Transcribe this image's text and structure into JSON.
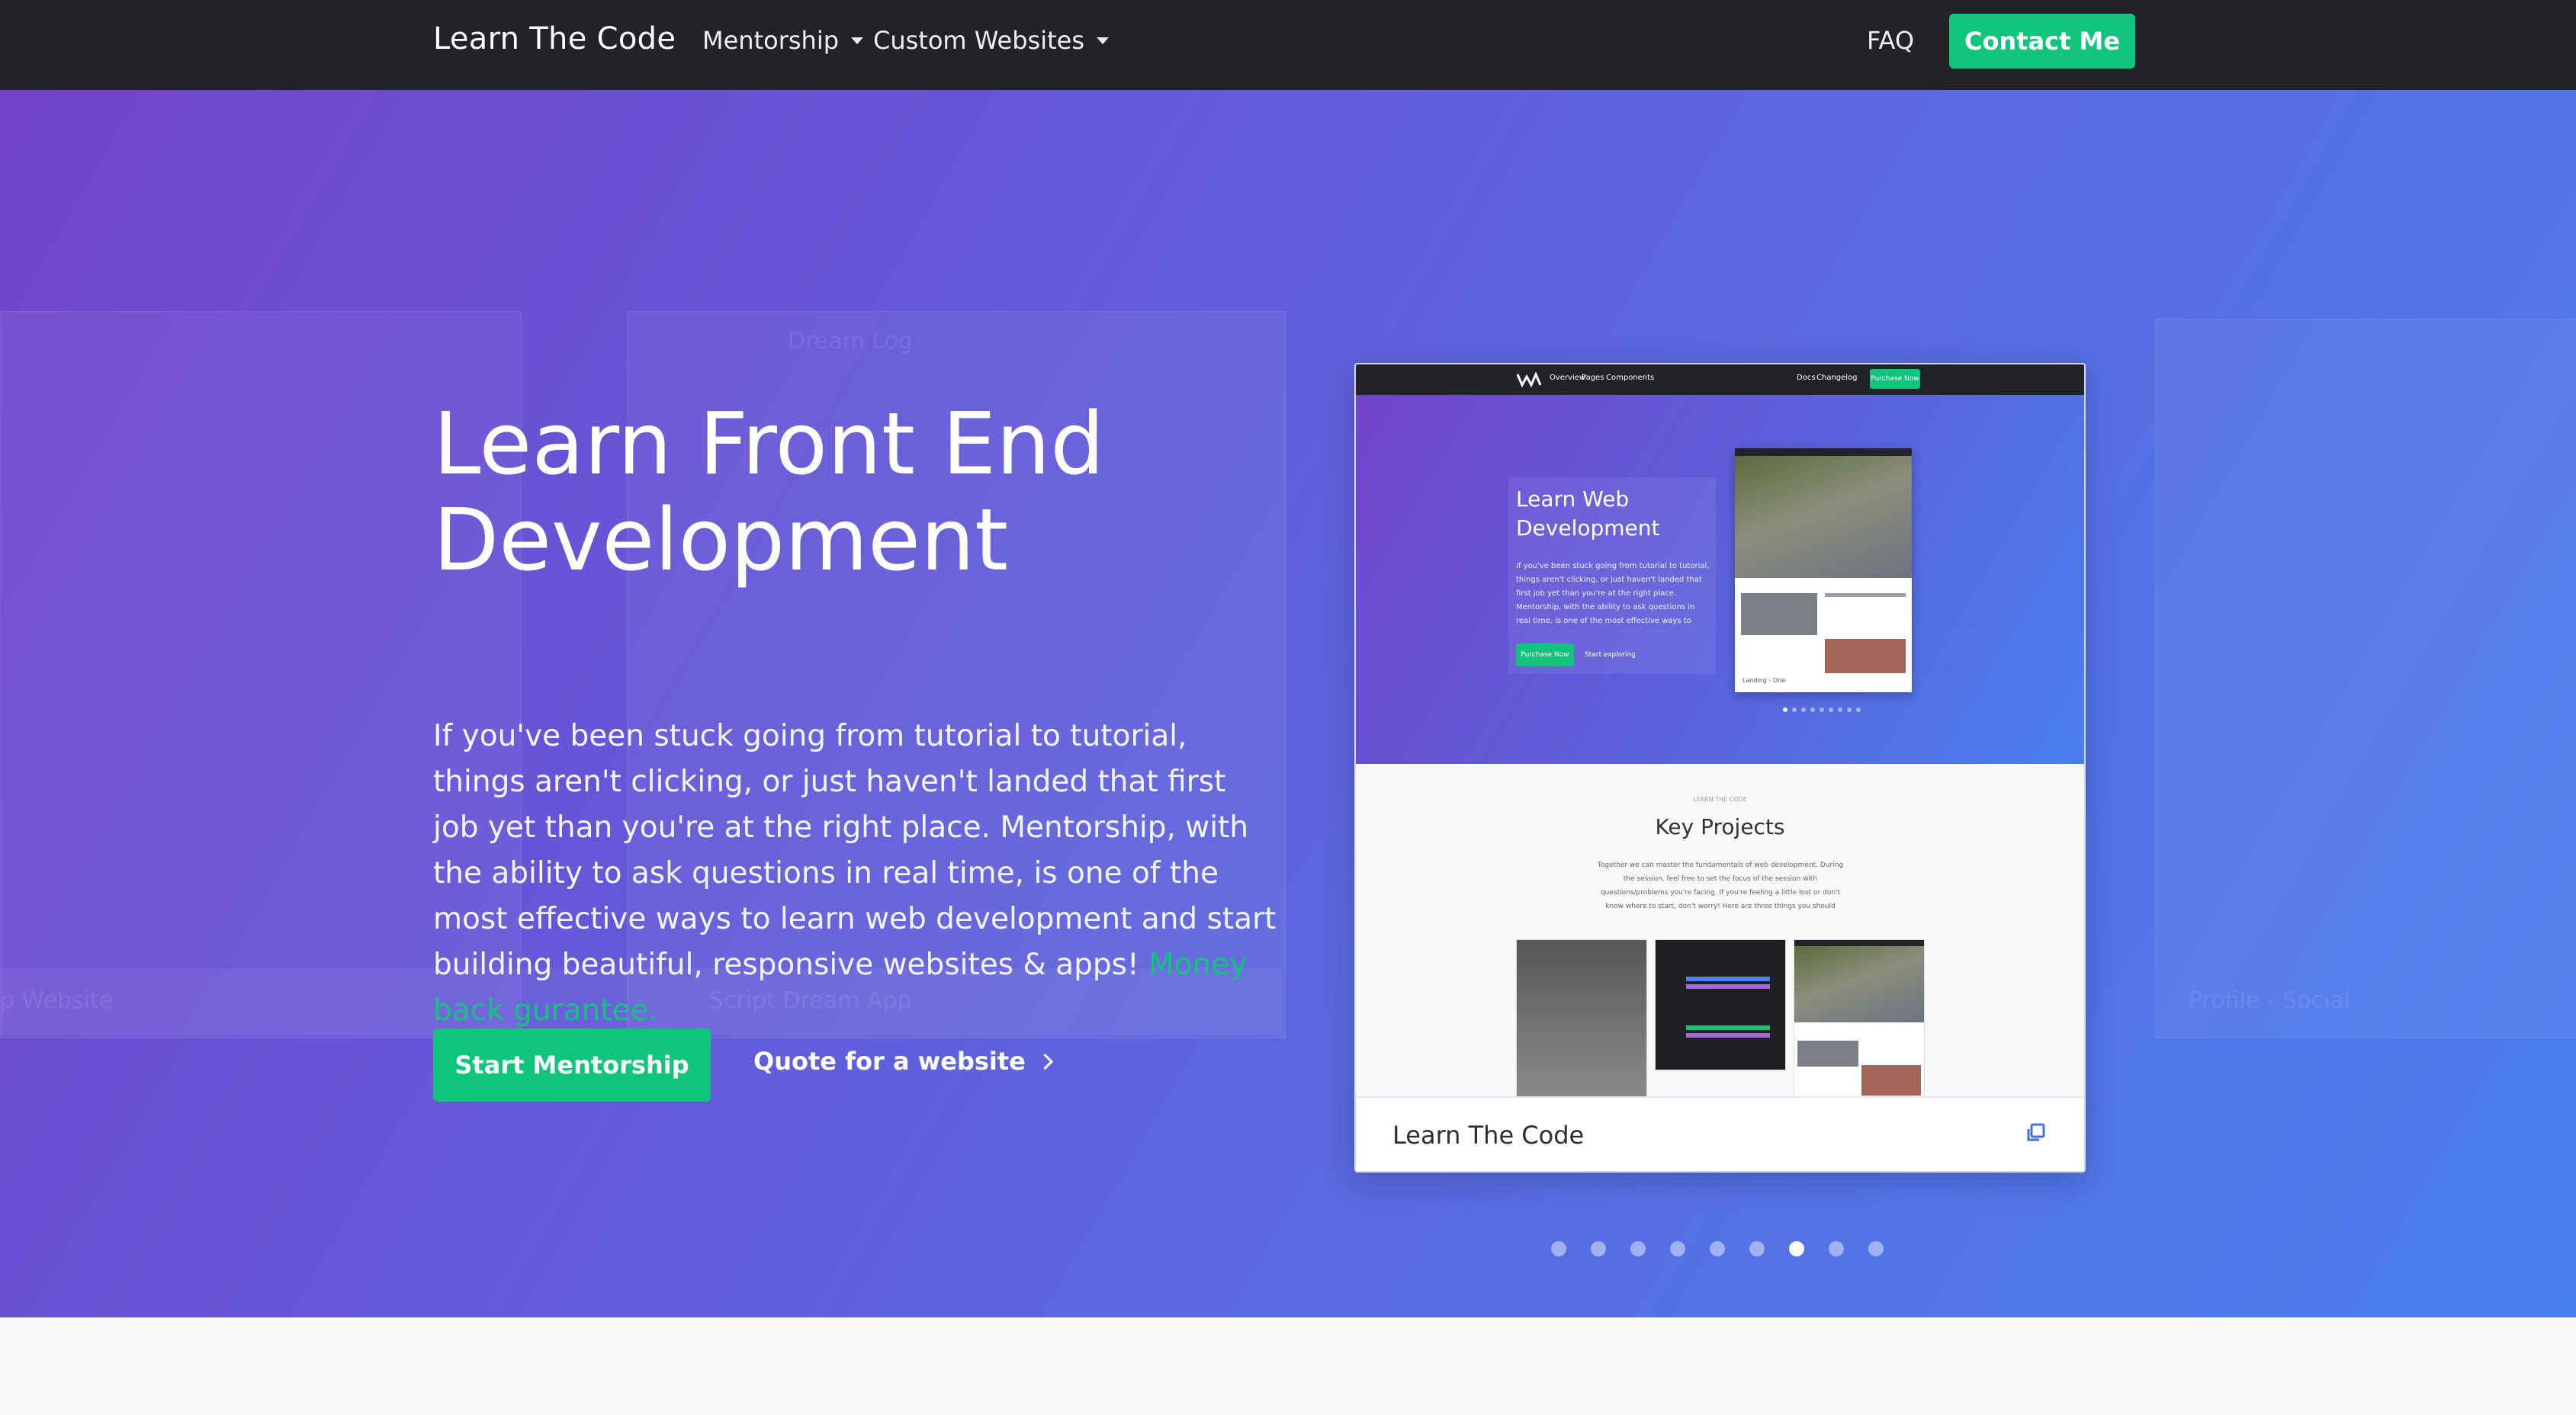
{
  "navbar": {
    "brand": "Learn The Code",
    "items": [
      {
        "label": "Mentorship"
      },
      {
        "label": "Custom Websites"
      }
    ],
    "faq": "FAQ",
    "contact": "Contact Me"
  },
  "hero": {
    "title_line1": "Learn Front End",
    "title_line2": "Development",
    "description": "If you've been stuck going from tutorial to tutorial, things aren't clicking, or just haven't landed that first job yet than you're at the right place. Mentorship, with the ability to ask questions in real time, is one of the most effective ways to learn web development and start building beautiful, responsive websites & apps!",
    "guarantee": "Money back gurantee.",
    "primary_button": "Start Mentorship",
    "secondary_link": "Quote for a website"
  },
  "background_cards": {
    "left_caption": "p Website",
    "middle_caption": "Script Dream App",
    "middle_label": "Dream Log",
    "right_caption": "Profile - Social"
  },
  "carousel": {
    "caption": "Learn The Code",
    "preview": {
      "nav_links": [
        "Overview",
        "Pages",
        "Components",
        "Docs",
        "Changelog",
        "Purchase Now"
      ],
      "title": "Learn Web Development",
      "body": "If you've been stuck going from tutorial to tutorial, things aren't clicking, or just haven't landed that first job yet than you're at the right place. Mentorship, with the ability to ask questions in real time, is one of the most effective ways to learn web development and start building beautiful, responsive websites & apps!",
      "button": "Purchase Now",
      "link": "Start exploring",
      "thumb_caption": "Landing - One",
      "section_eyebrow": "LEARN THE CODE",
      "section_title": "Key Projects",
      "section_body": "Together we can master the fundamentals of web development. During the session, feel free to set the focus of the session with questions/problems you're facing. If you're feeling a little lost or don't know where to start, don't worry! Here are three things you should eventually have under your belt."
    },
    "slide_count": 9,
    "active_index": 6
  },
  "colors": {
    "accent": "#10c47c",
    "navbar": "#212328",
    "hero_start": "#7244cc",
    "hero_end": "#4a7ff0"
  }
}
